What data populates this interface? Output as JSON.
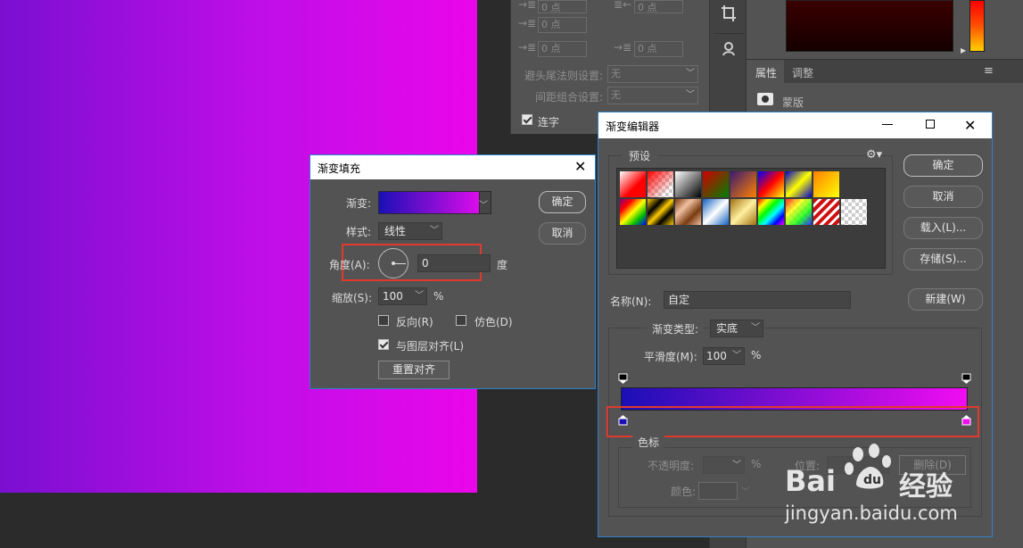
{
  "paragraph_panel": {
    "indent_left_value": "0 点",
    "indent_right_value": "0 点",
    "first_line_value": "0 点",
    "space_before_value": "0 点",
    "space_after_value": "0 点",
    "kinsoku_label": "避头尾法则设置:",
    "kinsoku_value": "无",
    "mojikumi_label": "间距组合设置:",
    "mojikumi_value": "无",
    "hyphen_label": "连字"
  },
  "props_panel": {
    "tab_properties": "属性",
    "tab_adjustments": "调整",
    "mask_label": "蒙版"
  },
  "gradient_fill": {
    "title": "渐变填充",
    "gradient_label": "渐变:",
    "style_label": "样式:",
    "style_value": "线性",
    "angle_label": "角度(A):",
    "angle_value": "0",
    "angle_unit": "度",
    "scale_label": "缩放(S):",
    "scale_value": "100",
    "scale_unit": "%",
    "reverse_label": "反向(R)",
    "dither_label": "仿色(D)",
    "align_label": "与图层对齐(L)",
    "reset_align_label": "重置对齐",
    "ok_label": "确定",
    "cancel_label": "取消",
    "reverse_checked": false,
    "dither_checked": false,
    "align_checked": true
  },
  "gradient_editor": {
    "title": "渐变编辑器",
    "presets_label": "预设",
    "ok_label": "确定",
    "cancel_label": "取消",
    "load_label": "载入(L)...",
    "save_label": "存储(S)...",
    "name_label": "名称(N):",
    "name_value": "自定",
    "new_label": "新建(W)",
    "type_label": "渐变类型:",
    "type_value": "实底",
    "smooth_label": "平滑度(M):",
    "smooth_value": "100",
    "smooth_unit": "%",
    "stops_group_label": "色标",
    "opacity_label": "不透明度:",
    "opacity_unit": "%",
    "position_label": "位置:",
    "color_label": "颜色:",
    "delete_label": "删除(D)",
    "gradient_start_color": "#1a0fb5",
    "gradient_end_color": "#f20cf2"
  },
  "watermark": {
    "brand": "Bai",
    "brand_cn": "经验",
    "url": "jingyan.baidu.com"
  },
  "colors": {
    "accent_highlight": "#e03a2e",
    "dialog_border": "#2e82c8"
  }
}
